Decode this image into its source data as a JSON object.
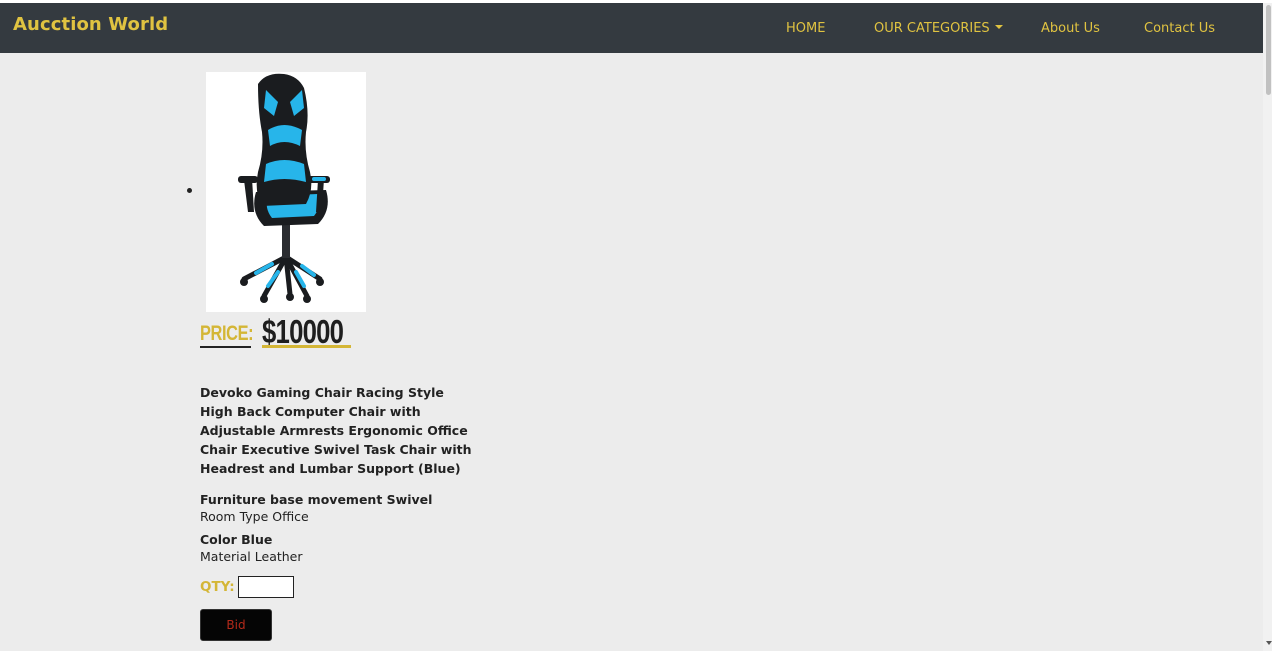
{
  "navbar": {
    "brand": "Aucction World",
    "links": [
      {
        "label": "HOME"
      },
      {
        "label": "OUR CATEGORIES"
      },
      {
        "label": "About Us"
      },
      {
        "label": "Contact Us"
      }
    ]
  },
  "product": {
    "price_label": "PRICE:",
    "price_value": "$10000",
    "title": "Devoko Gaming Chair Racing Style High Back Computer Chair with Adjustable Armrests Ergonomic Office Chair Executive Swivel Task Chair with Headrest and Lumbar Support (Blue)",
    "specs": [
      {
        "text": "Furniture base movement Swivel"
      },
      {
        "text": "Room Type Office"
      },
      {
        "text": "Color Blue"
      },
      {
        "text": "Material Leather"
      }
    ],
    "qty_label": "QTY:",
    "qty_value": "",
    "bid_label": "Bid",
    "chair_colors": {
      "black": "#1a1c1f",
      "blue": "#27b5ea"
    }
  },
  "theme": {
    "accent": "#e0c341",
    "navbar_bg": "#343a40",
    "page_bg": "#ececec"
  }
}
